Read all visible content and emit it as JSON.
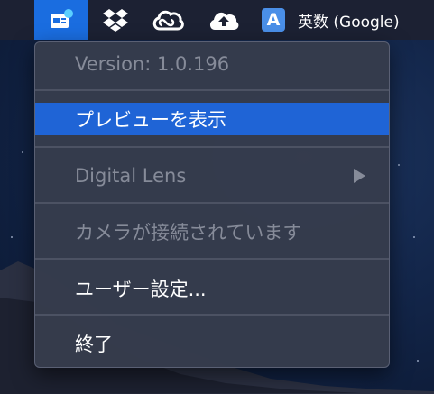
{
  "menubar": {
    "app_icon": "camera-preview-app-icon",
    "extra_icons": [
      "dropbox-icon",
      "creative-cloud-icon",
      "cloud-upload-icon"
    ],
    "input_method": {
      "badge": "A",
      "label": "英数 (Google)"
    },
    "colors": {
      "bar": "#1c2133",
      "active_item": "#1a6de0",
      "status_dot": "#5ad0ff"
    }
  },
  "menu": {
    "version": "Version: 1.0.196",
    "preview": "プレビューを表示",
    "digital_lens": "Digital Lens",
    "camera_status": "カメラが接続されています",
    "user_settings": "ユーザー設定...",
    "quit": "終了",
    "colors": {
      "background": "#363c4c",
      "highlight": "#1f64d6",
      "disabled_text": "#868b99"
    }
  }
}
